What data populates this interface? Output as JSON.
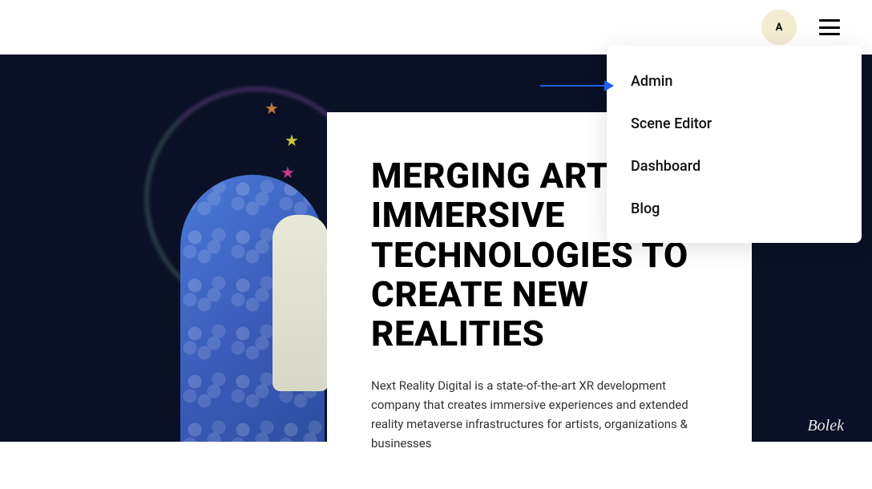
{
  "header": {
    "avatar_letter": "A"
  },
  "dropdown": {
    "items": [
      {
        "label": "Admin"
      },
      {
        "label": "Scene Editor"
      },
      {
        "label": "Dashboard"
      },
      {
        "label": "Blog"
      }
    ]
  },
  "hero": {
    "heading": "MERGING ART & IMMERSIVE TECHNOLOGIES TO CREATE NEW REALITIES",
    "body": "Next Reality Digital is a state-of-the-art XR development company that creates immersive experiences and extended reality metaverse infrastructures for artists, organizations & businesses",
    "corner_label": "Bolek"
  }
}
